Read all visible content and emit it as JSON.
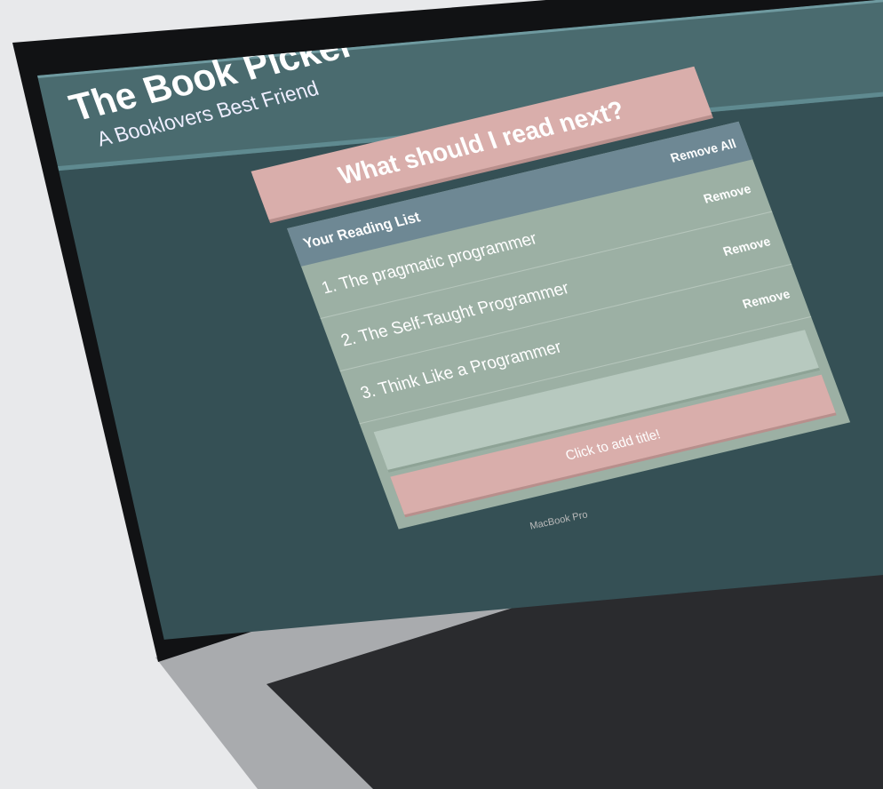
{
  "header": {
    "title": "The Book Picker",
    "subtitle": "A Booklovers Best Friend"
  },
  "main": {
    "prompt": "What should I read next?"
  },
  "reading_list": {
    "heading": "Your Reading List",
    "remove_all_label": "Remove All",
    "items": [
      {
        "title": "1. The pragmatic programmer",
        "remove_label": "Remove"
      },
      {
        "title": "2. The Self-Taught Programmer",
        "remove_label": "Remove"
      },
      {
        "title": "3. Think Like a Programmer",
        "remove_label": "Remove"
      }
    ],
    "input_value": "",
    "add_button_label": "Click to add title!"
  },
  "device": {
    "brand_label": "MacBook Pro"
  },
  "colors": {
    "header": "#4a6b6f",
    "background": "#355055",
    "accent_pink": "#d9aeab",
    "list_header": "#6e8894",
    "list_body": "#9cb0a4"
  }
}
